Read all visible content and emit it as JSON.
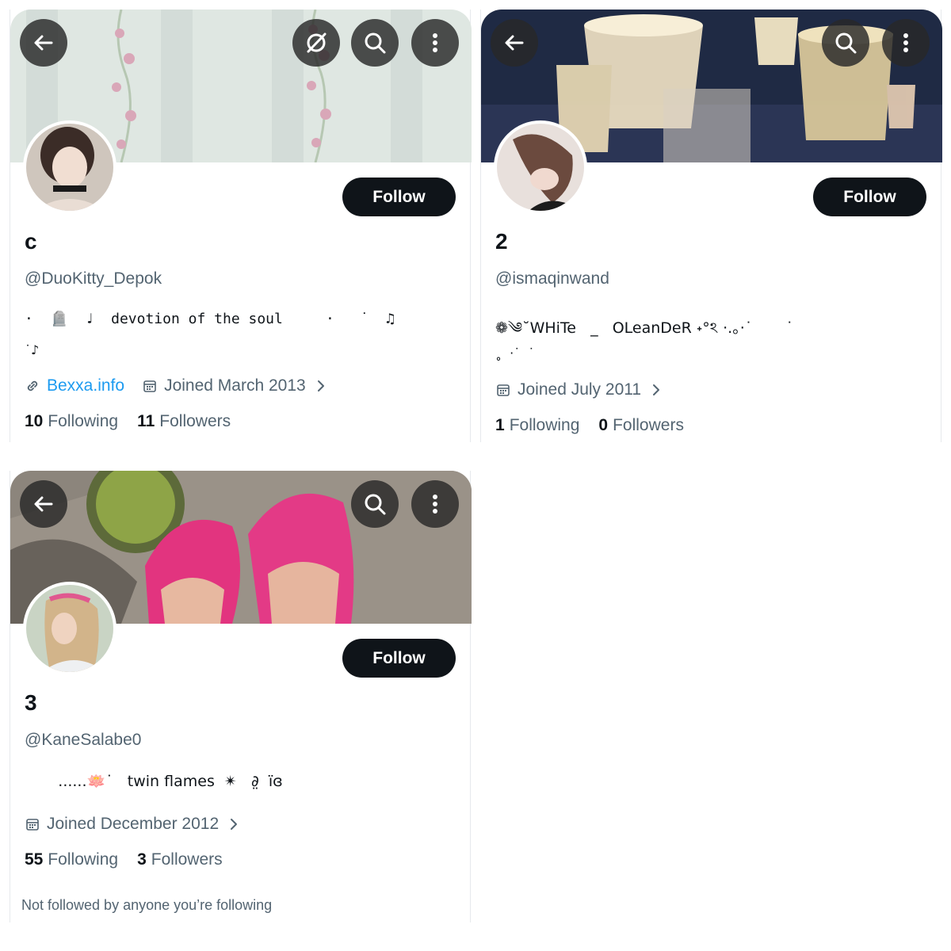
{
  "profiles": [
    {
      "display_name": "c",
      "handle": "@DuoKitty_Depok",
      "bio": "·  🪦  ♩  devotion of the soul     ·   ˙  ♫",
      "bio_line2": "˙♪",
      "link": "Bexxa.info",
      "joined": "Joined March 2013",
      "following_count": "10",
      "following_label": "Following",
      "followers_count": "11",
      "followers_label": "Followers",
      "follow_label": "Follow"
    },
    {
      "display_name": "2",
      "handle": "@ismaqinwand",
      "bio": "❁༄˘WHiTe   _   OLeanDeR ˖°ঽ ·.。·˙       ˙",
      "bio_line2": "˳  ·˙  ˙",
      "joined": "Joined July 2011",
      "following_count": "1",
      "following_label": "Following",
      "followers_count": "0",
      "followers_label": "Followers",
      "follow_label": "Follow"
    },
    {
      "display_name": "3",
      "handle": "@KaneSalabe0",
      "bio": "       ......🪷˙   twin flames  ✴   ∂̤  ïɞ",
      "joined": "Joined December 2012",
      "following_count": "55",
      "following_label": "Following",
      "followers_count": "3",
      "followers_label": "Followers",
      "follow_label": "Follow",
      "note": "Not followed by anyone you’re following"
    }
  ],
  "colors": {
    "follow_button": "#0f1419",
    "link": "#1d9bf0",
    "secondary_text": "#536471"
  },
  "icons": [
    "back-arrow-icon",
    "grok-icon",
    "search-icon",
    "more-icon",
    "link-icon",
    "calendar-icon",
    "chevron-right-icon"
  ]
}
